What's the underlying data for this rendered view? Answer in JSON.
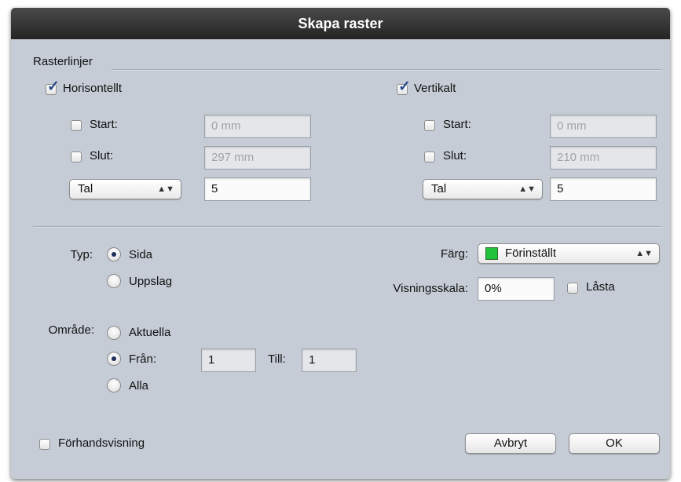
{
  "window": {
    "title": "Skapa raster"
  },
  "gridlines": {
    "section_label": "Rasterlinjer",
    "horizontal": {
      "label": "Horisontellt",
      "checked": true,
      "start_label": "Start:",
      "start_value": "0 mm",
      "end_label": "Slut:",
      "end_value": "297 mm",
      "mode": "Tal",
      "count": "5"
    },
    "vertical": {
      "label": "Vertikalt",
      "checked": true,
      "start_label": "Start:",
      "start_value": "0 mm",
      "end_label": "Slut:",
      "end_value": "210 mm",
      "mode": "Tal",
      "count": "5"
    }
  },
  "type": {
    "label": "Typ:",
    "options": [
      "Sida",
      "Uppslag"
    ],
    "selected": "Sida"
  },
  "color": {
    "label": "Färg:",
    "value": "Förinställt",
    "swatch": "#22c33b"
  },
  "scale": {
    "label": "Visningsskala:",
    "value": "0%",
    "locked_label": "Låsta"
  },
  "range": {
    "label": "Område:",
    "options": [
      "Aktuella",
      "Från:",
      "Alla"
    ],
    "selected": "Från:",
    "from_value": "1",
    "to_label": "Till:",
    "to_value": "1"
  },
  "preview_label": "Förhandsvisning",
  "buttons": {
    "cancel": "Avbryt",
    "ok": "OK"
  }
}
